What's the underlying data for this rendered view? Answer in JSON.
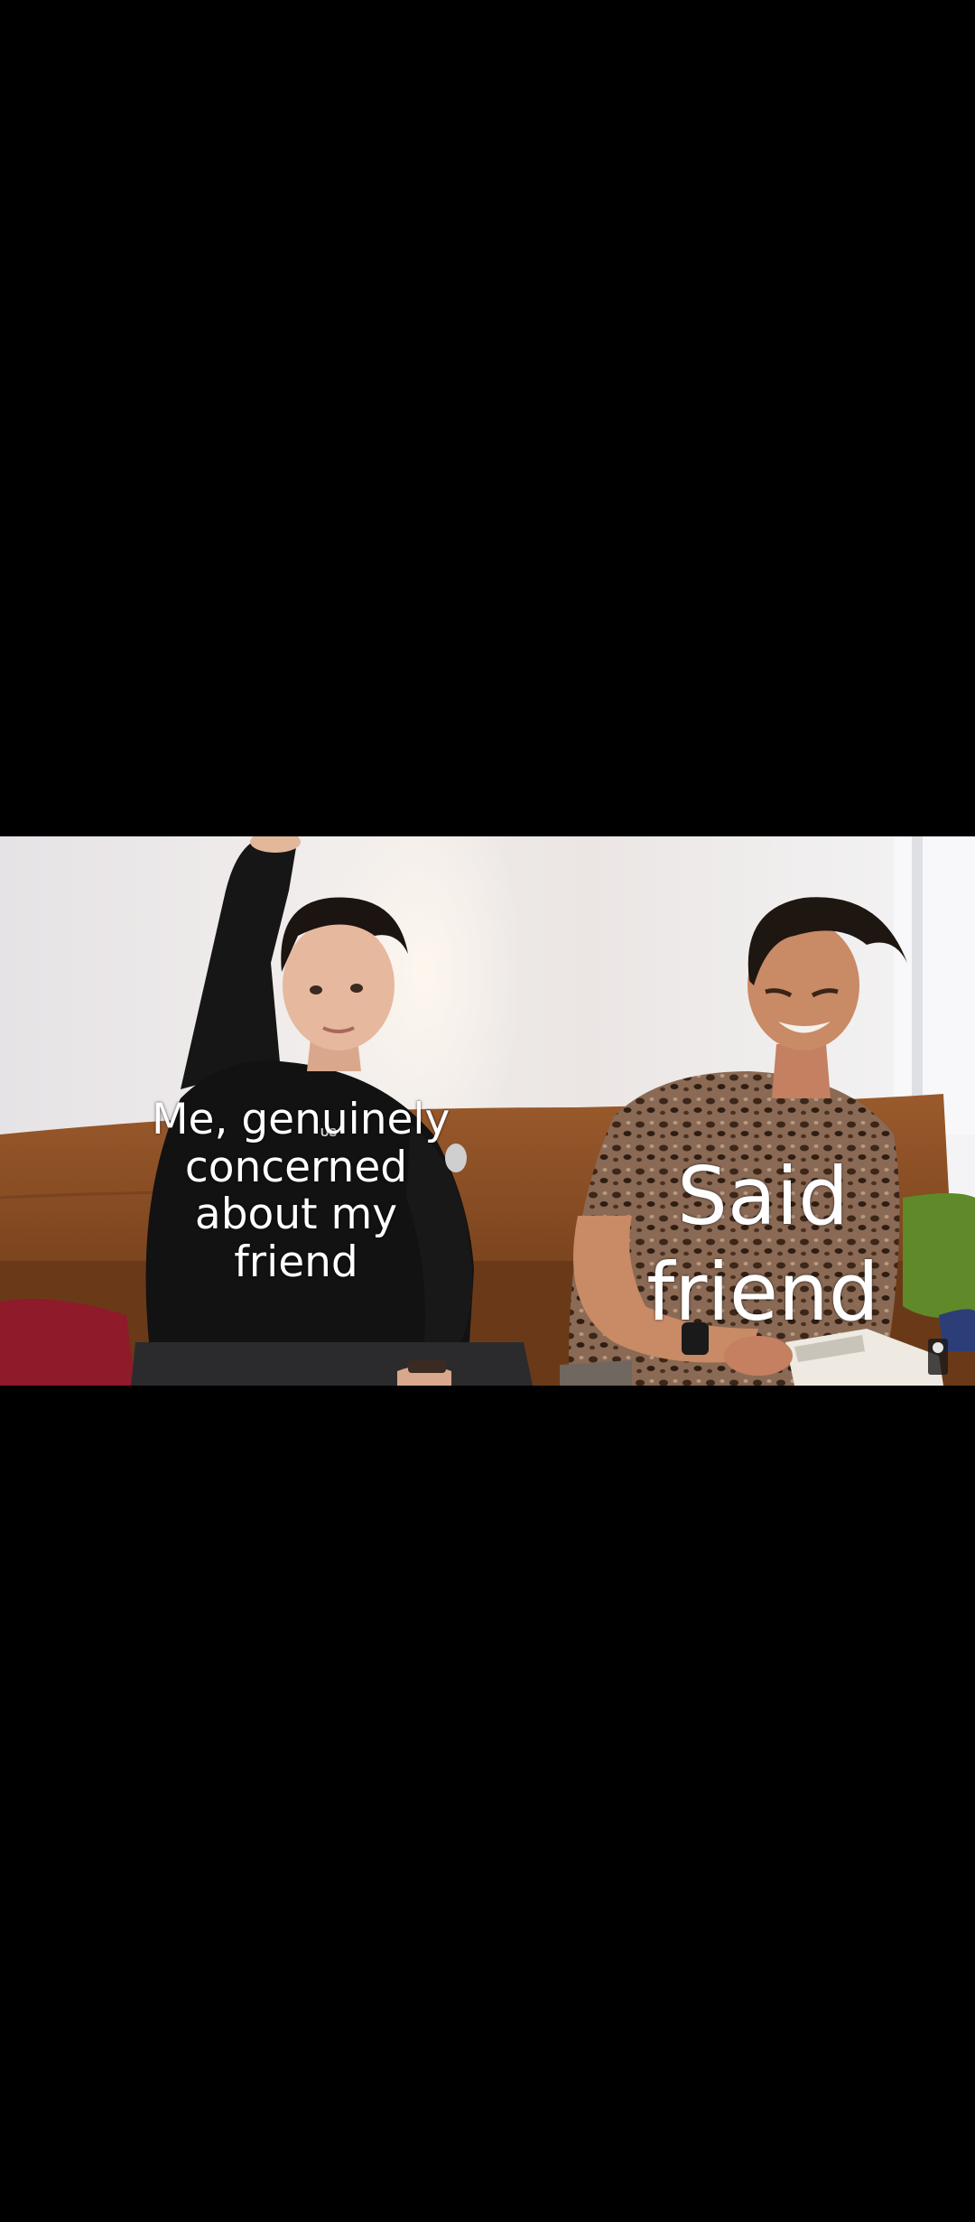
{
  "meme": {
    "left_caption": [
      "Me, genuinely",
      "concerned",
      "about my",
      "friend"
    ],
    "right_caption": [
      "Said",
      "friend"
    ]
  },
  "colors": {
    "background": "#000000",
    "wall": "#ece9ea",
    "couch": "#8f5125",
    "caption_text": "#ffffff"
  },
  "scene": {
    "left_person": "man-raising-hand",
    "right_person": "man-laughing-with-book",
    "hoodie_text": "US"
  }
}
